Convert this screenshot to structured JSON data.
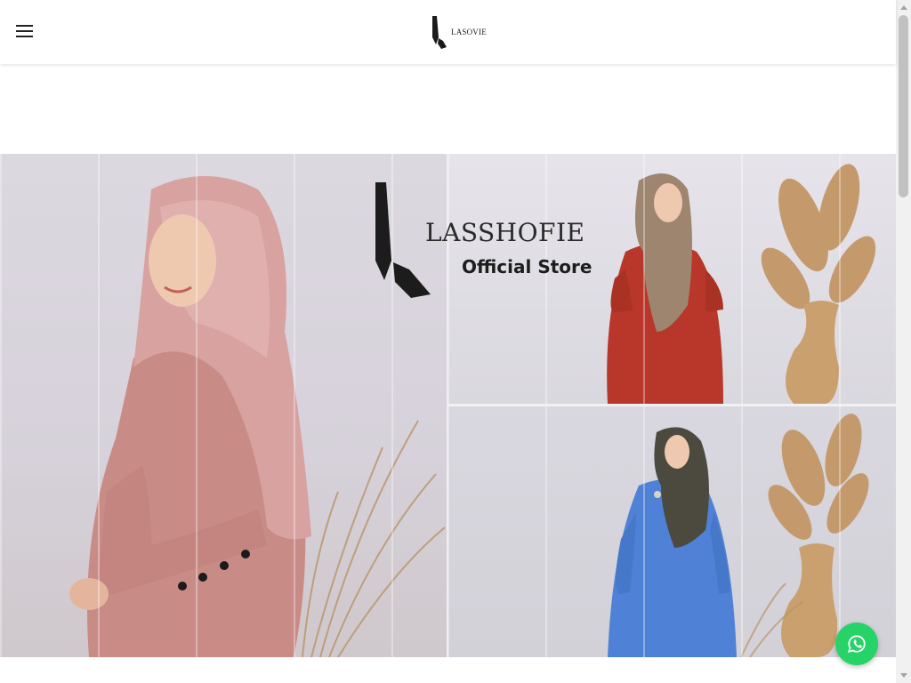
{
  "header": {
    "menu_icon": "hamburger-menu-icon",
    "brand_logo": "lasovie-logo-icon",
    "brand_text": "LASOVIE"
  },
  "hero": {
    "store_name": "LASSHOFIE",
    "store_subtitle": "Official Store"
  },
  "whatsapp": {
    "icon": "whatsapp-icon",
    "color": "#25d366"
  },
  "colors": {
    "header_bg": "#ffffff",
    "accent_green": "#25d366",
    "dress_pink": "#c98b86",
    "dress_red": "#b8372a",
    "dress_blue": "#4f82d6"
  }
}
